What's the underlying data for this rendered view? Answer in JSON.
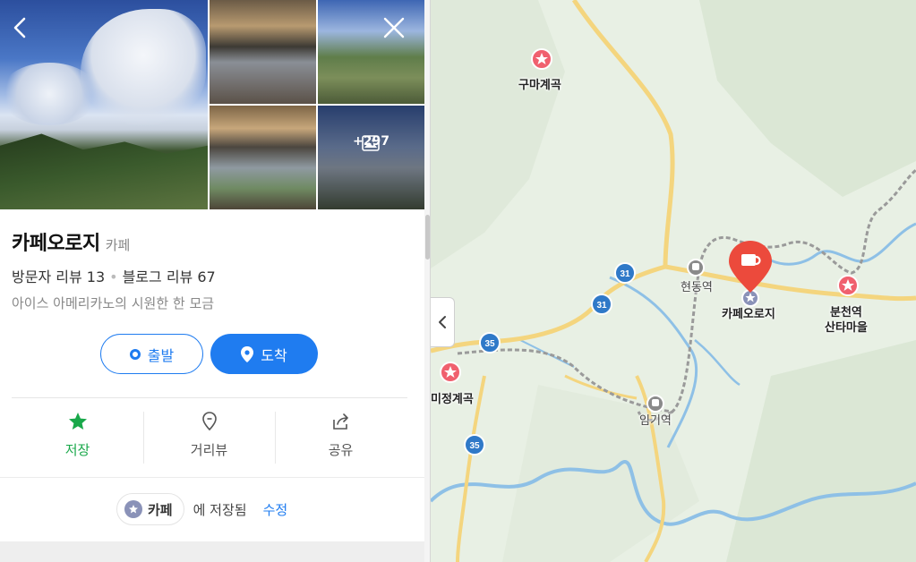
{
  "place": {
    "name": "카페오로지",
    "category": "카페",
    "visitor_reviews": "방문자 리뷰 13",
    "blog_reviews": "블로그 리뷰 67",
    "description": "아이스 아메리카노의 시원한 한 모금",
    "photo_more": "+297"
  },
  "buttons": {
    "start": "출발",
    "arrive": "도착"
  },
  "actions": {
    "save": "저장",
    "street_view": "거리뷰",
    "share": "공유"
  },
  "saved": {
    "folder": "카페",
    "text": "에 저장됨",
    "edit": "수정"
  },
  "map": {
    "labels": {
      "guma": "구마계곡",
      "hyeondong": "현동역",
      "cafe": "카페오로지",
      "buncheon_1": "분천역",
      "buncheon_2": "산타마을",
      "mijeong": "미정계곡",
      "imgi": "임기역"
    },
    "roads": [
      "31",
      "31",
      "35",
      "35"
    ]
  },
  "colors": {
    "accent": "#1f7cf0",
    "save_green": "#19a84a",
    "marker_red": "#ec4a3c"
  }
}
